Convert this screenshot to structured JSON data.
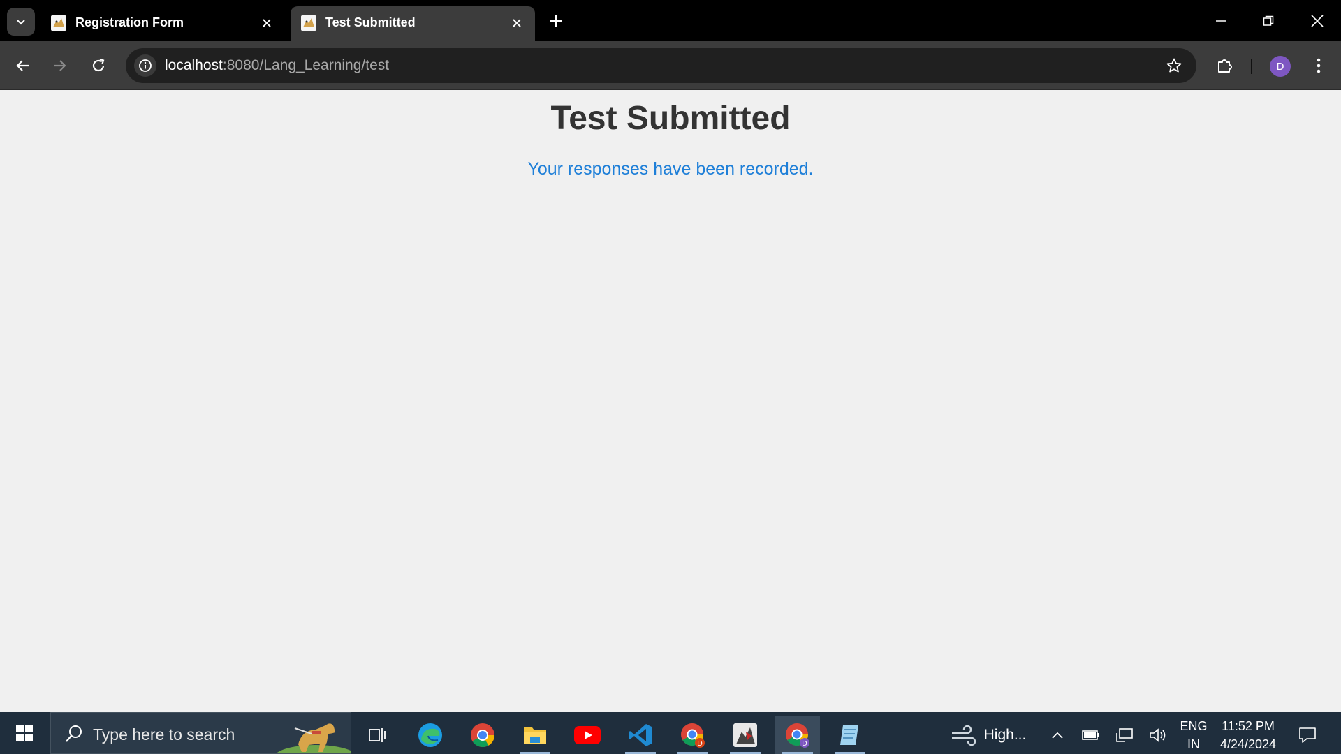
{
  "browser": {
    "tabs": [
      {
        "title": "Registration Form",
        "active": false
      },
      {
        "title": "Test Submitted",
        "active": true
      }
    ],
    "url_host": "localhost",
    "url_rest": ":8080/Lang_Learning/test",
    "profile_initial": "D"
  },
  "page": {
    "heading": "Test Submitted",
    "message": "Your responses have been recorded."
  },
  "taskbar": {
    "search_placeholder": "Type here to search",
    "weather": "High...",
    "lang_top": "ENG",
    "lang_bottom": "IN",
    "time": "11:52 PM",
    "date": "4/24/2024",
    "apps": [
      "task-view",
      "edge",
      "chrome",
      "file-explorer",
      "youtube",
      "vscode",
      "chrome-profile-d",
      "java-app",
      "chrome-active",
      "notepad"
    ]
  },
  "colors": {
    "page_background": "#f0f0f0",
    "heading": "#333333",
    "message": "#1e7fd8",
    "profile": "#7e57c2"
  }
}
